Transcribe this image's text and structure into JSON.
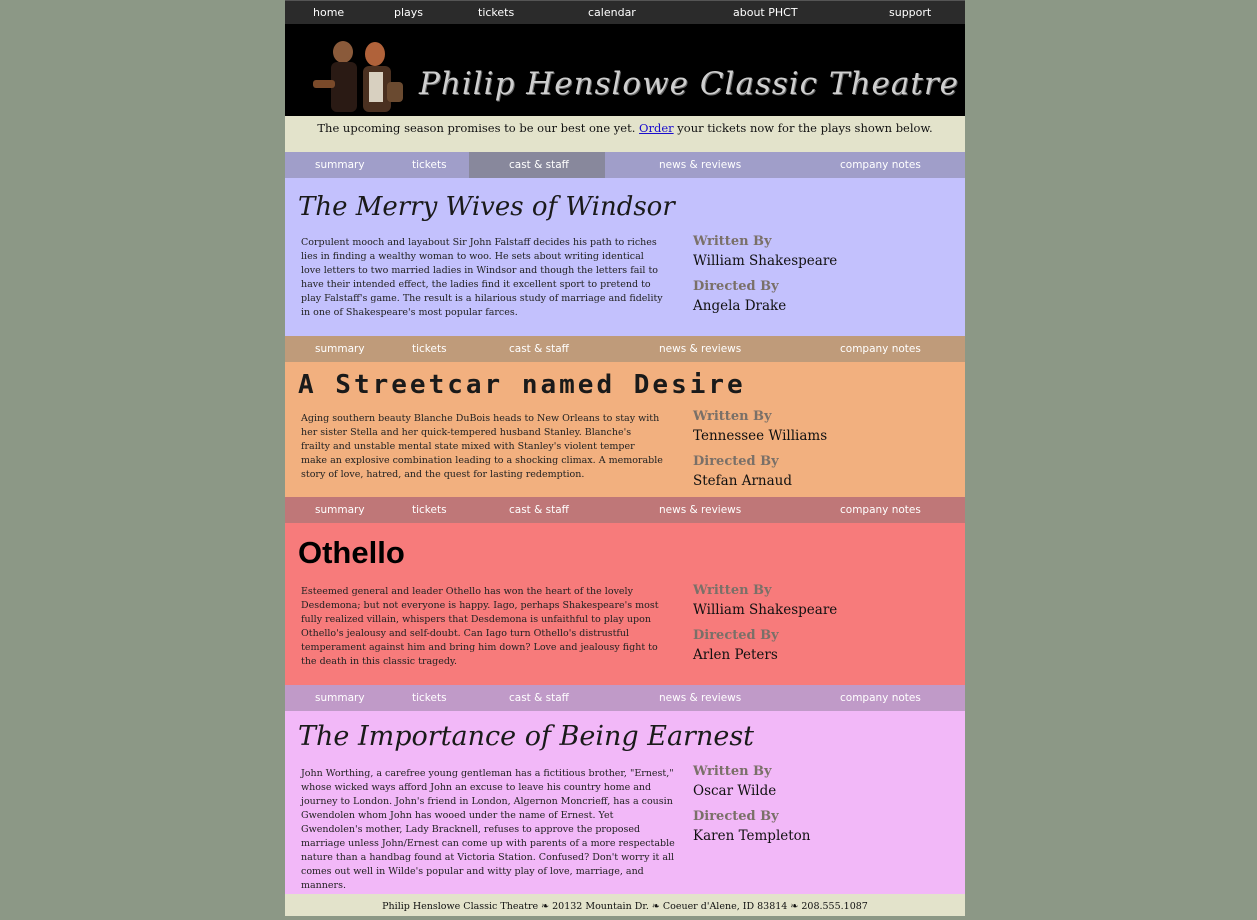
{
  "topnav": {
    "home": "home",
    "plays": "plays",
    "tickets": "tickets",
    "calendar": "calendar",
    "about": "about PHCT",
    "support": "support"
  },
  "banner": {
    "title": "Philip Henslowe Classic Theatre"
  },
  "intro": {
    "before": "The upcoming season promises to be our best one yet. ",
    "link": "Order",
    "after": " your tickets now for the plays shown below."
  },
  "subnav_labels": {
    "summary": "summary",
    "tickets": "tickets",
    "cast": "cast & staff",
    "news": "news & reviews",
    "notes": "company notes"
  },
  "credit_labels": {
    "written": "Written By",
    "directed": "Directed By"
  },
  "plays": [
    {
      "title": "The Merry Wives of Windsor",
      "description": "Corpulent mooch and layabout Sir John Falstaff decides his path to riches lies in finding a wealthy woman to woo. He sets about writing identical love letters to two married ladies in Windsor and though the letters fail to have their intended effect, the ladies find it excellent sport to pretend to play Falstaff's game. The result is a hilarious study of marriage and fidelity in one of Shakespeare's most popular farces.",
      "writer": "William Shakespeare",
      "director": "Angela Drake"
    },
    {
      "title": "A Streetcar named Desire",
      "description": "Aging southern beauty Blanche DuBois heads to New Orleans to stay with her sister Stella and her quick-tempered husband Stanley. Blanche's frailty and unstable mental state mixed with Stanley's violent temper make an explosive combination leading to a shocking climax. A memorable story of love, hatred, and the quest for lasting redemption.",
      "writer": "Tennessee Williams",
      "director": "Stefan Arnaud"
    },
    {
      "title": "Othello",
      "description": "Esteemed general and leader Othello has won the heart of the lovely Desdemona; but not everyone is happy. Iago, perhaps Shakespeare's most fully realized villain, whispers that Desdemona is unfaithful to play upon Othello's jealousy and self-doubt. Can Iago turn Othello's distrustful temperament against him and bring him down? Love and jealousy fight to the death in this classic tragedy.",
      "writer": "William Shakespeare",
      "director": "Arlen Peters"
    },
    {
      "title": "The Importance of Being Earnest",
      "description": "John Worthing, a carefree young gentleman has a fictitious brother, \"Ernest,\" whose wicked ways afford John an excuse to leave his country home and journey to London. John's friend in London, Algernon Moncrieff, has a cousin Gwendolen whom John has wooed under the name of Ernest. Yet Gwendolen's mother, Lady Bracknell, refuses to approve the proposed marriage unless John/Ernest can come up with parents of a more respectable nature than a handbag found at Victoria Station. Confused? Don't worry it all comes out well in Wilde's popular and witty play of love, marriage, and manners.",
      "writer": "Oscar Wilde",
      "director": "Karen Templeton"
    }
  ],
  "footer": "Philip Henslowe Classic Theatre ❧ 20132 Mountain Dr. ❧ Coeuer d'Alene, ID 83814 ❧ 208.555.1087",
  "colors": {
    "background": "#8c9886",
    "nav_bar": "#2b2b2b",
    "intro_bg": "#e3e3cb",
    "play1_nav": "#a09ec9",
    "play1_bg": "#c3c1fd",
    "play2_nav": "#bf9b7a",
    "play2_bg": "#f2b07f",
    "play3_nav": "#bf7778",
    "play3_bg": "#f77b7b",
    "play4_nav": "#c09ac8",
    "play4_bg": "#f2b8f8"
  }
}
